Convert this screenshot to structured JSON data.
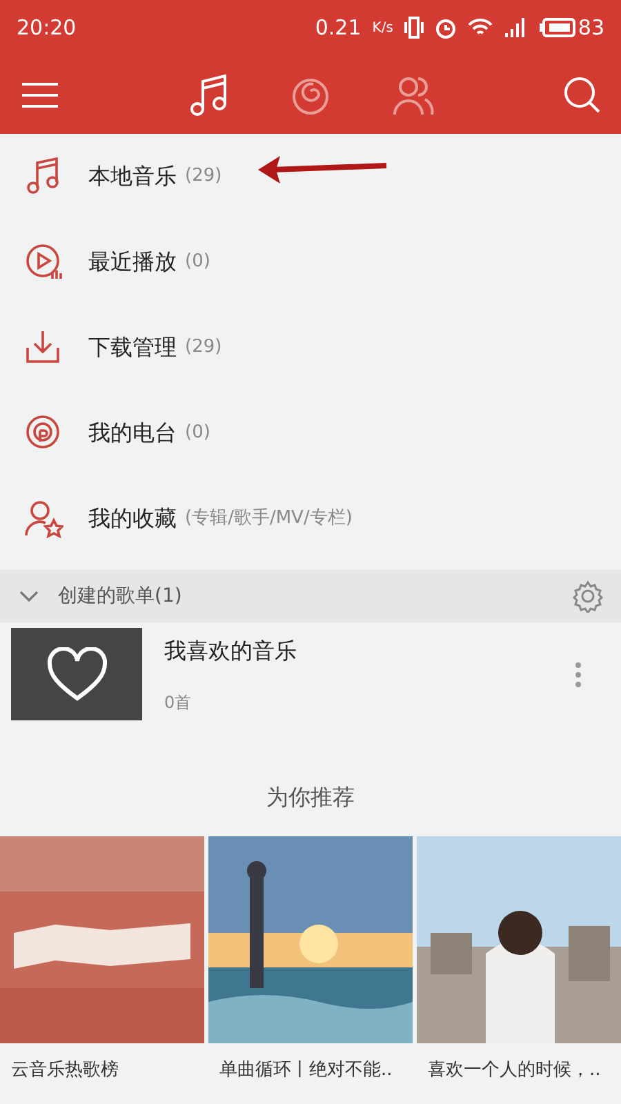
{
  "status_bar": {
    "time": "20:20",
    "speed": "0.21",
    "speed_unit": "K/s",
    "battery": "83"
  },
  "tabs": [
    {
      "kind": "music",
      "selected": true
    },
    {
      "kind": "cloud",
      "selected": false
    },
    {
      "kind": "friends",
      "selected": false
    }
  ],
  "menu": [
    {
      "kind": "note",
      "title": "本地音乐",
      "count": "(29)"
    },
    {
      "kind": "recent",
      "title": "最近播放",
      "count": "(0)"
    },
    {
      "kind": "download",
      "title": "下载管理",
      "count": "(29)"
    },
    {
      "kind": "radio",
      "title": "我的电台",
      "count": "(0)"
    },
    {
      "kind": "collect",
      "title": "我的收藏",
      "count": "(专辑/歌手/MV/专栏)"
    }
  ],
  "playlist_section": {
    "title": "创建的歌单(1)",
    "expanded": true,
    "playlists": [
      {
        "title": "我喜欢的音乐",
        "count": "0首"
      }
    ]
  },
  "recommend": {
    "title": "为你推荐",
    "cards": [
      {
        "kind": "chart",
        "caption": "云音乐热歌榜"
      },
      {
        "kind": "picture",
        "caption": "单曲循环丨绝对不能.."
      },
      {
        "kind": "picture",
        "caption": "喜欢一个人的时候，.."
      }
    ]
  }
}
